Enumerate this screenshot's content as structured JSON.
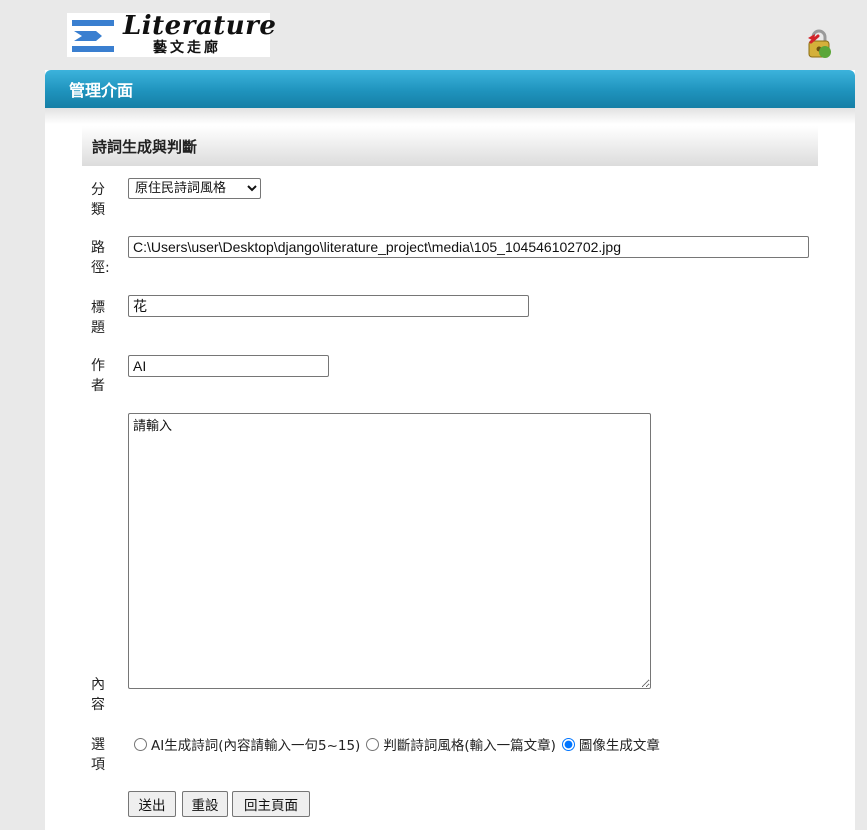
{
  "logo": {
    "word": "Literature",
    "subtitle": "藝文走廊"
  },
  "panel": {
    "title": "管理介面"
  },
  "section": {
    "title": "詩詞生成與判斷"
  },
  "form": {
    "category": {
      "label": "分類",
      "selected": "原住民詩詞風格"
    },
    "path": {
      "label": "路徑:",
      "value": "C:\\Users\\user\\Desktop\\django\\literature_project\\media\\105_104546102702.jpg"
    },
    "title": {
      "label": "標題",
      "value": "花"
    },
    "author": {
      "label": "作者",
      "value": "AI"
    },
    "content": {
      "label": "內容",
      "value": "請輸入"
    },
    "options": {
      "label": "選項",
      "items": [
        {
          "label": "AI生成詩詞(內容請輸入一句5~15)",
          "checked": false
        },
        {
          "label": "判斷詩詞風格(輸入一篇文章)",
          "checked": false
        },
        {
          "label": "圖像生成文章",
          "checked": true
        }
      ]
    },
    "buttons": {
      "submit": "送出",
      "reset": "重設",
      "home": "回主頁面"
    }
  }
}
